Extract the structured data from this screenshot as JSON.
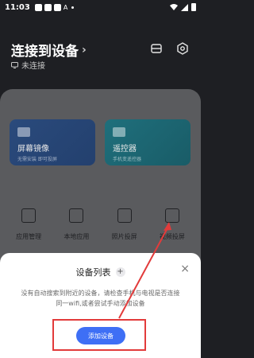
{
  "status_bar": {
    "time": "11:03",
    "a_label": "A"
  },
  "header": {
    "title": "连接到设备",
    "subtitle": "未连接"
  },
  "features": [
    {
      "label": "屏幕镜像",
      "desc": "无需安装 即可投屏"
    },
    {
      "label": "遥控器",
      "desc": "手机变遥控器"
    }
  ],
  "tools": [
    {
      "label": "应用管理"
    },
    {
      "label": "本地应用"
    },
    {
      "label": "照片投屏"
    },
    {
      "label": "视频投屏"
    }
  ],
  "sheet": {
    "title": "设备列表",
    "plus": "+",
    "close": "×",
    "desc": "没有自动搜索到附近的设备，请检查手机与电视是否连接同一wifi,或者尝试手动添加设备",
    "add_button": "添加设备"
  },
  "colors": {
    "accent": "#3e6ff5",
    "highlight": "#e23b3b",
    "arrow": "#e23b3b"
  }
}
